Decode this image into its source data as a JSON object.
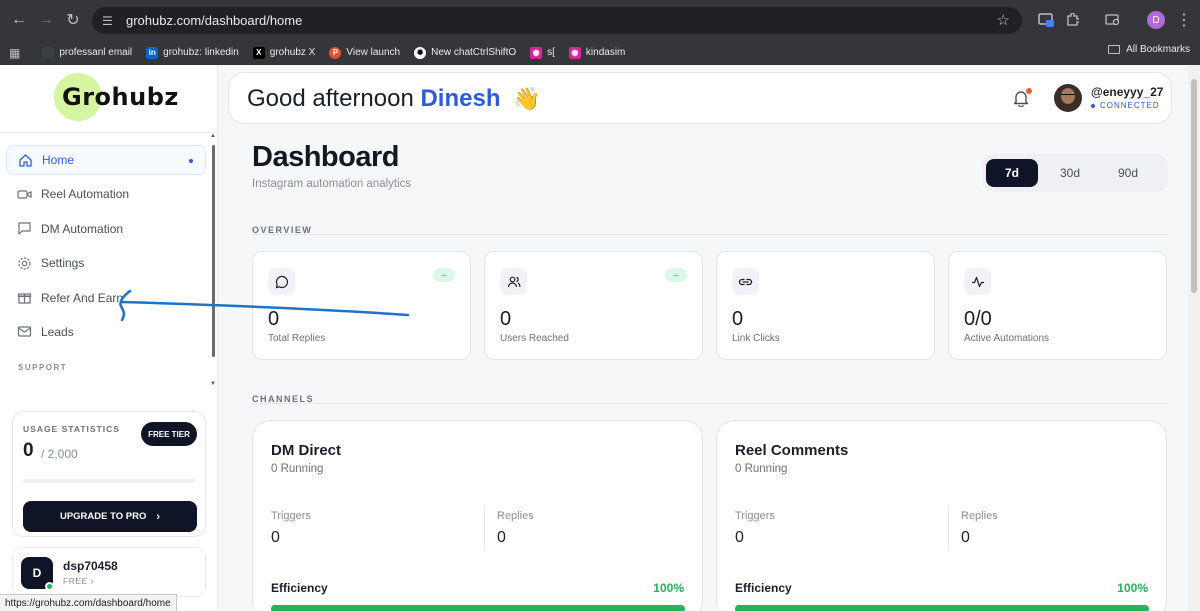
{
  "browser": {
    "url": "grohubz.com/dashboard/home",
    "profile_initial": "D",
    "bookmarks": [
      {
        "label": "professanl email",
        "icon": "globe-icon"
      },
      {
        "label": "grohubz: linkedin",
        "icon": "linkedin-icon"
      },
      {
        "label": "grohubz X",
        "icon": "x-icon"
      },
      {
        "label": "View launch",
        "icon": "producthunt-icon"
      },
      {
        "label": "New chatCtrlShiftO",
        "icon": "chatgpt-icon"
      },
      {
        "label": "s[",
        "icon": "instagram-icon"
      },
      {
        "label": "kindasim",
        "icon": "instagram-icon"
      }
    ],
    "all_bookmarks": "All Bookmarks",
    "status_url": "https://grohubz.com/dashboard/home"
  },
  "sidebar": {
    "logo": "Grohubz",
    "items": [
      {
        "label": "Home",
        "icon": "home-icon",
        "active": true
      },
      {
        "label": "Reel Automation",
        "icon": "video-icon"
      },
      {
        "label": "DM Automation",
        "icon": "message-icon"
      },
      {
        "label": "Settings",
        "icon": "gear-icon"
      },
      {
        "label": "Refer And Earn",
        "icon": "gift-icon"
      },
      {
        "label": "Leads",
        "icon": "mail-icon"
      }
    ],
    "support_label": "SUPPORT",
    "usage": {
      "title": "USAGE STATISTICS",
      "tier": "FREE TIER",
      "used": "0",
      "limit": "/ 2,000",
      "progress": 0,
      "upgrade": "UPGRADE TO PRO"
    },
    "user": {
      "initial": "D",
      "name": "dsp70458",
      "plan": "FREE"
    }
  },
  "header": {
    "greeting": "Good afternoon",
    "name": "Dinesh",
    "emoji": "👋",
    "handle": "@eneyyy_27",
    "status": "CONNECTED"
  },
  "main": {
    "title": "Dashboard",
    "subtitle": "Instagram automation analytics",
    "ranges": [
      "7d",
      "30d",
      "90d"
    ],
    "selected_range": "7d",
    "overview_label": "OVERVIEW",
    "stats": [
      {
        "value": "0",
        "label": "Total Replies",
        "icon": "chat-bubble-icon",
        "badge": "–"
      },
      {
        "value": "0",
        "label": "Users Reached",
        "icon": "users-icon",
        "badge": "–"
      },
      {
        "value": "0",
        "label": "Link Clicks",
        "icon": "link-icon",
        "badge": ""
      },
      {
        "value": "0/0",
        "label": "Active Automations",
        "icon": "activity-icon",
        "badge": ""
      }
    ],
    "channels_label": "CHANNELS",
    "channels": [
      {
        "title": "DM Direct",
        "running": "0 Running",
        "triggers_label": "Triggers",
        "triggers": "0",
        "replies_label": "Replies",
        "replies": "0",
        "efficiency_label": "Efficiency",
        "efficiency": "100%"
      },
      {
        "title": "Reel Comments",
        "running": "0 Running",
        "triggers_label": "Triggers",
        "triggers": "0",
        "replies_label": "Replies",
        "replies": "0",
        "efficiency_label": "Efficiency",
        "efficiency": "100%"
      }
    ]
  }
}
